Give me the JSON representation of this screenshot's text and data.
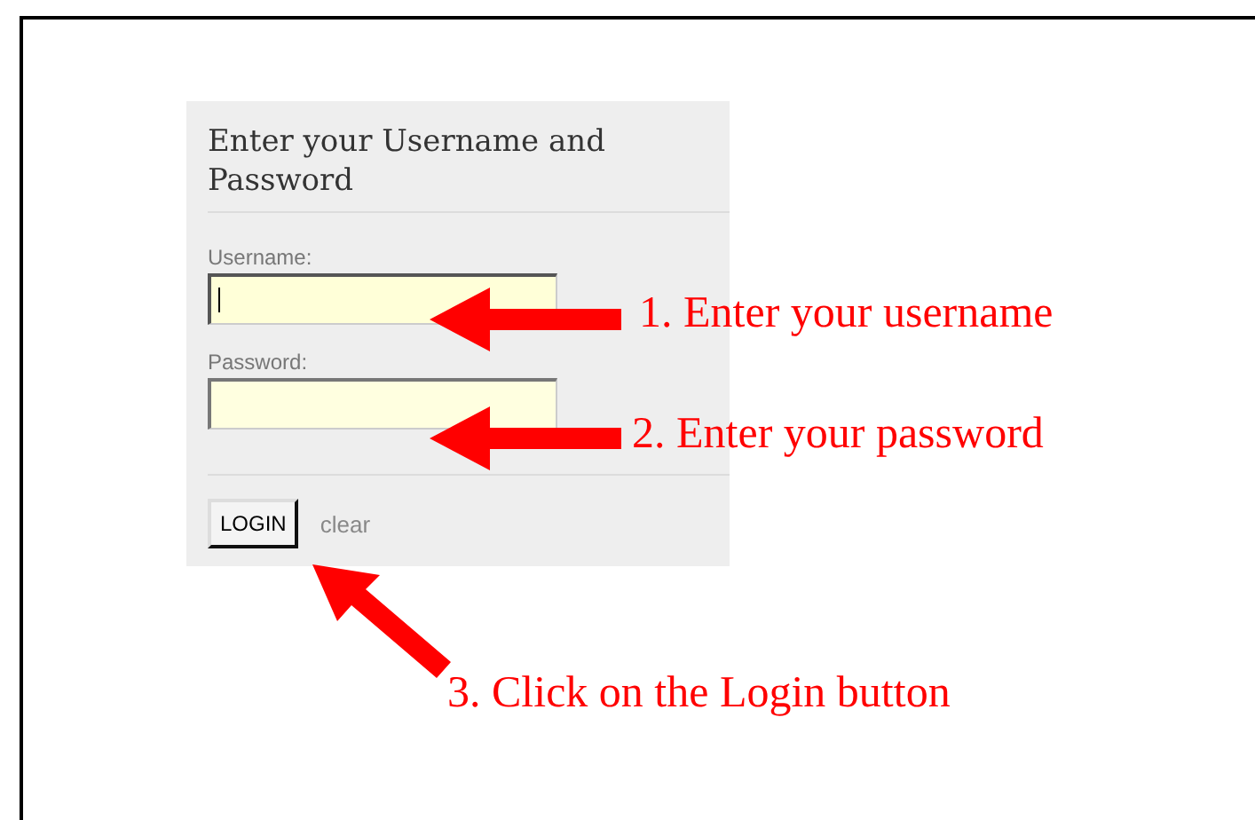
{
  "login_panel": {
    "title": "Enter your Username and Password",
    "fields": [
      {
        "label": "Username:",
        "focused": true
      },
      {
        "label": "Password:",
        "focused": false
      }
    ],
    "login_button": "LOGIN",
    "clear_link": "clear"
  },
  "annotations": [
    {
      "text": "1. Enter your username",
      "kind": "left"
    },
    {
      "text": "2. Enter your password",
      "kind": "left"
    },
    {
      "text": "3. Click on the Login button",
      "kind": "up-left"
    }
  ]
}
